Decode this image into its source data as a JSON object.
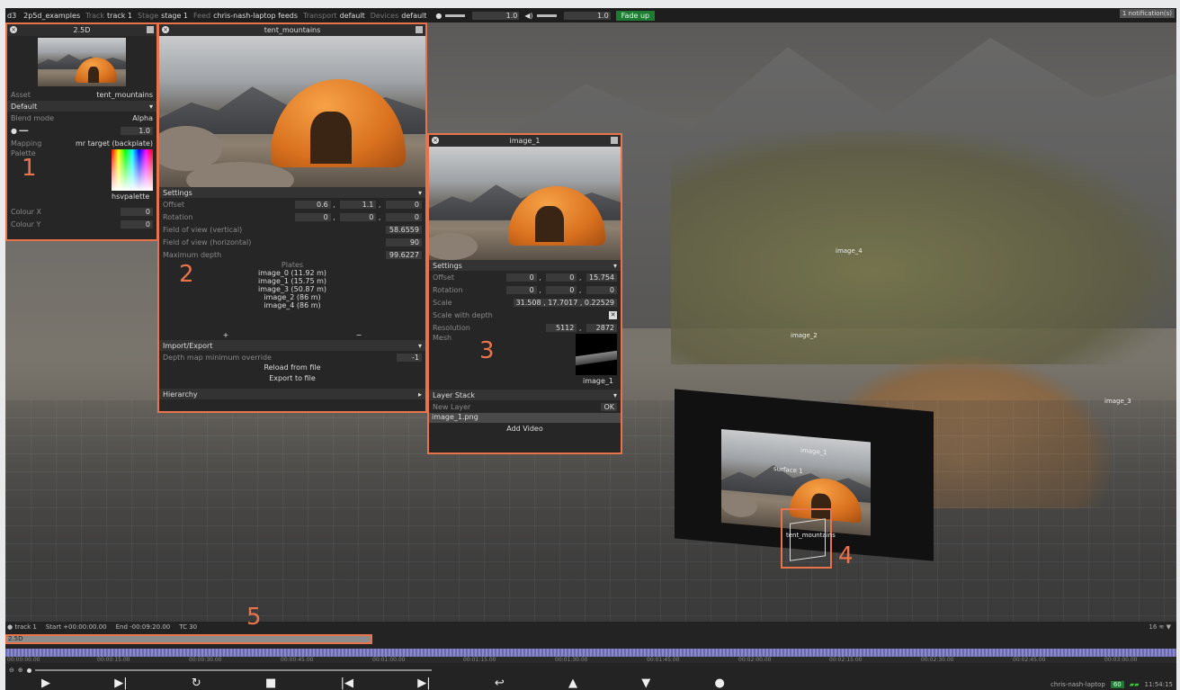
{
  "topbar": {
    "app": "d3",
    "project": "2p5d_examples",
    "track_k": "Track",
    "track_v": "track 1",
    "stage_k": "Stage",
    "stage_v": "stage 1",
    "feed_k": "Feed",
    "feed_v": "chris-nash-laptop feeds",
    "transport_k": "Transport",
    "transport_v": "default",
    "devices_k": "Devices",
    "devices_v": "default",
    "bright_val": "1.0",
    "vol_val": "1.0",
    "fade_btn": "Fade up",
    "notif": "1 notification(s)"
  },
  "viewport": {
    "labels": [
      "image_4",
      "image_2",
      "image_3",
      "image_1",
      "surface 1",
      "tent_mountains"
    ]
  },
  "panel1": {
    "title": "2.5D",
    "asset_label": "Asset",
    "asset_value": "tent_mountains",
    "section": "Default",
    "blend_label": "Blend mode",
    "blend_value": "Alpha",
    "bright_value": "1.0",
    "mapping_label": "Mapping",
    "mapping_value": "mr target (backplate)",
    "palette_label": "Palette",
    "palette_name": "hsvpalette",
    "colourx_label": "Colour X",
    "colourx_value": "0",
    "coloury_label": "Colour Y",
    "coloury_value": "0"
  },
  "panel2": {
    "title": "tent_mountains",
    "settings": "Settings",
    "offset_label": "Offset",
    "offset": [
      "0.6",
      "1.1",
      "0"
    ],
    "rotation_label": "Rotation",
    "rotation": [
      "0",
      "0",
      "0"
    ],
    "fovv_label": "Field of view (vertical)",
    "fovv": "58.6559",
    "fovh_label": "Field of view (horizontal)",
    "fovh": "90",
    "maxd_label": "Maximum depth",
    "maxd": "99.6227",
    "plates_title": "Plates",
    "plates": [
      "image_0 (11.92 m)",
      "image_1 (15.75 m)",
      "image_3 (50.87 m)",
      "image_2 (86 m)",
      "image_4 (86 m)"
    ],
    "plus": "+",
    "minus": "−",
    "importexport": "Import/Export",
    "depth_override_label": "Depth map minimum override",
    "depth_override": "-1",
    "reload": "Reload from file",
    "export": "Export to file",
    "hierarchy": "Hierarchy"
  },
  "panel3": {
    "title": "image_1",
    "settings": "Settings",
    "offset_label": "Offset",
    "offset": [
      "0",
      "0",
      "15.754"
    ],
    "rotation_label": "Rotation",
    "rotation": [
      "0",
      "0",
      "0"
    ],
    "scale_label": "Scale",
    "scale": "31.508 , 17.7017 , 0.22529",
    "swd_label": "Scale with depth",
    "swd": "✕",
    "res_label": "Resolution",
    "res": [
      "5112",
      "2872"
    ],
    "mesh_label": "Mesh",
    "mesh_name": "image_1",
    "layerstack": "Layer Stack",
    "newlayer_label": "New Layer",
    "ok": "OK",
    "layer_item": "image_1.png",
    "addvideo": "Add Video"
  },
  "annotations": [
    "1",
    "2",
    "3",
    "4",
    "5"
  ],
  "timeline": {
    "track": "track 1",
    "start": "Start +00:00:00.00",
    "end": "End -00:09:20.00",
    "tc": "TC 30",
    "track_bar": "2.5D",
    "ticks": [
      "00:00:00.00",
      "00:00:15.00",
      "00:00:30.00",
      "00:00:45.00",
      "00:01:00.00",
      "00:01:15.00",
      "00:01:30.00",
      "00:01:45.00",
      "00:02:00.00",
      "00:02:15.00",
      "00:02:30.00",
      "00:02:45.00",
      "00:03:00.00"
    ],
    "right_ctrl": "16 ≋ ▼",
    "machine": "chris-nash-laptop",
    "fps": "60",
    "clock": "11:54:15"
  },
  "transport_icons": [
    "play-icon",
    "play-section-icon",
    "loop-icon",
    "stop-icon",
    "skip-back-icon",
    "skip-forward-icon",
    "return-icon",
    "up-icon",
    "down-icon",
    "record-icon"
  ]
}
